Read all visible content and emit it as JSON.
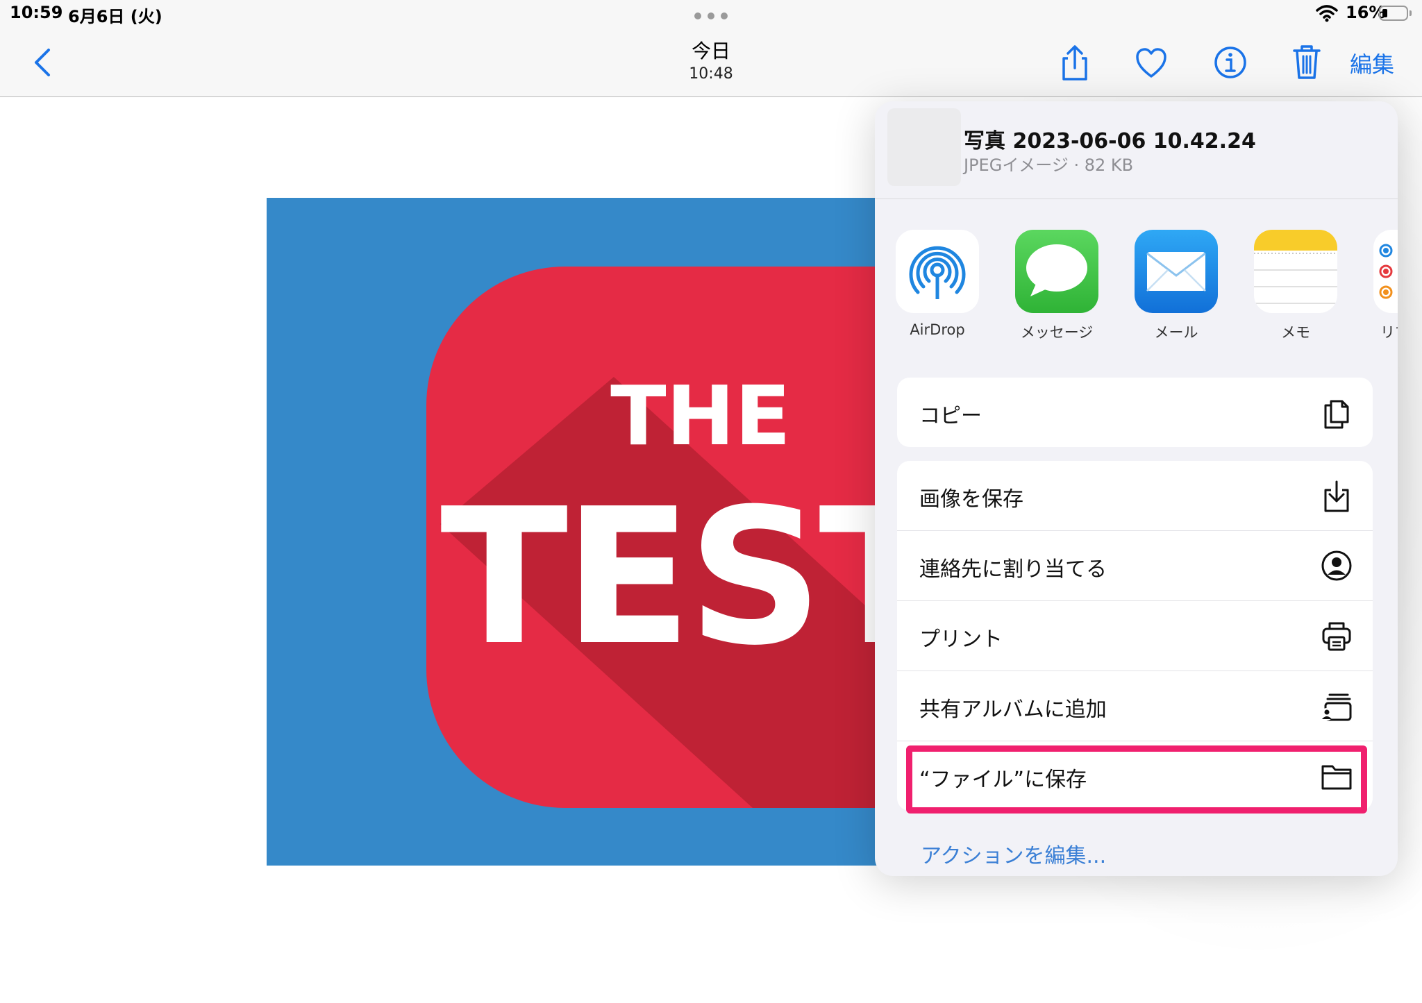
{
  "status_bar": {
    "time": "10:59",
    "date": "6月6日 (火)",
    "battery": "16%"
  },
  "nav": {
    "title": "今日",
    "subtitle": "10:48",
    "edit_label": "編集"
  },
  "photo": {
    "line1": "THE",
    "line2": "TEST"
  },
  "share_sheet": {
    "file_name": "写真 2023-06-06 10.42.24",
    "file_meta": "JPEGイメージ · 82 KB",
    "apps": [
      {
        "label": "AirDrop",
        "icon": "airdrop-icon"
      },
      {
        "label": "メッセージ",
        "icon": "messages-icon"
      },
      {
        "label": "メール",
        "icon": "mail-icon"
      },
      {
        "label": "メモ",
        "icon": "notes-icon"
      },
      {
        "label": "リマ",
        "icon": "reminders-icon"
      }
    ],
    "copy_group": [
      {
        "label": "コピー",
        "icon": "copy-icon"
      }
    ],
    "actions": [
      {
        "label": "画像を保存",
        "icon": "download-icon"
      },
      {
        "label": "連絡先に割り当てる",
        "icon": "contact-icon"
      },
      {
        "label": "プリント",
        "icon": "printer-icon"
      },
      {
        "label": "共有アルバムに追加",
        "icon": "shared-album-icon"
      },
      {
        "label": "“ファイル”に保存",
        "icon": "folder-icon"
      }
    ],
    "edit_actions": "アクションを編集..."
  },
  "colors": {
    "accent": "#1a73e8",
    "highlight": "#f0206e",
    "photo_bg": "#3589c9",
    "photo_red": "#e52b45"
  }
}
